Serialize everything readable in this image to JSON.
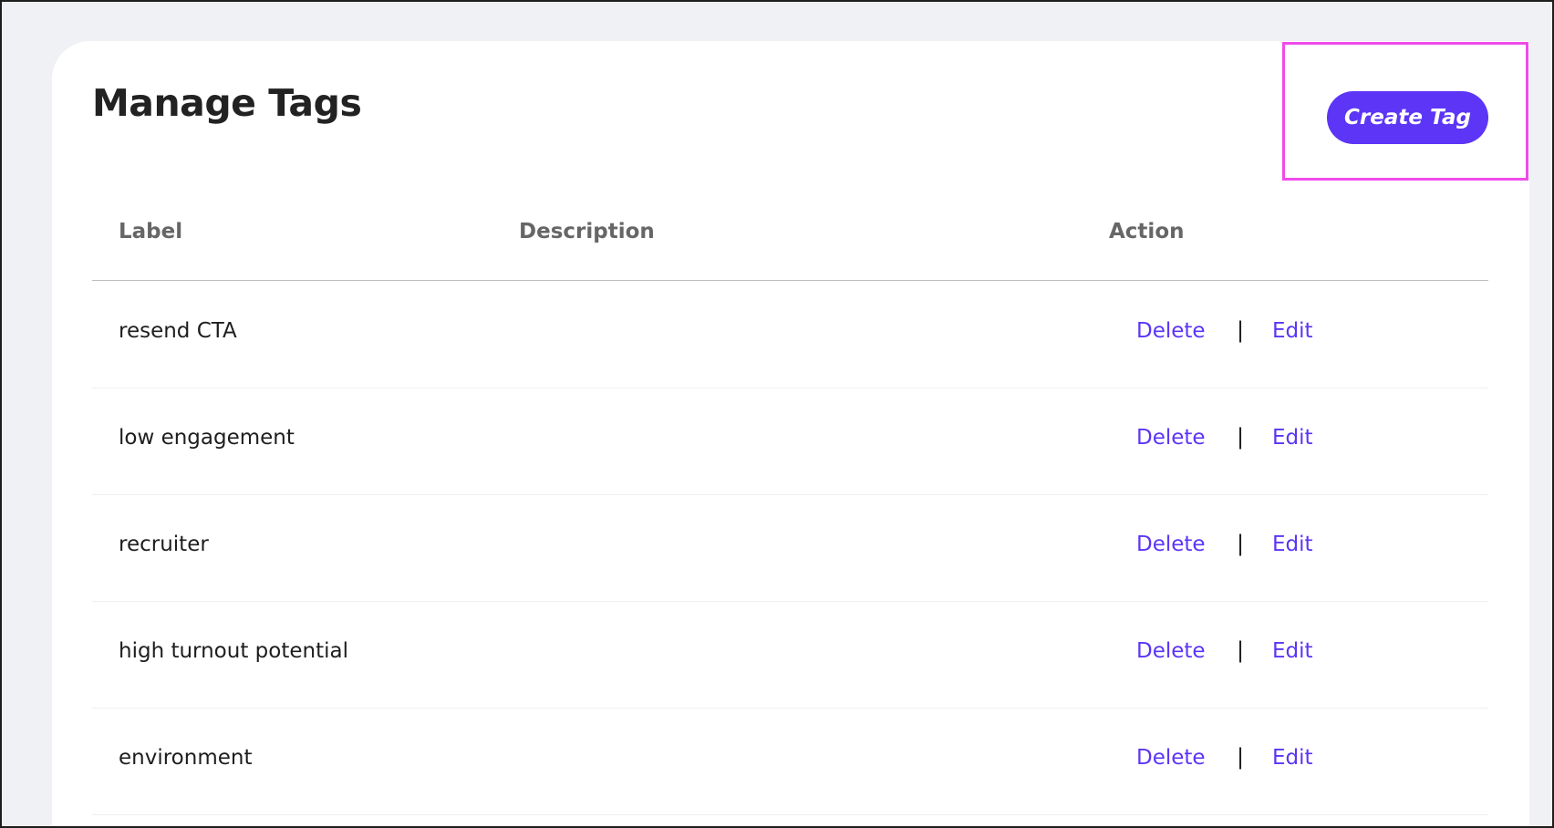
{
  "page": {
    "title": "Manage Tags",
    "create_button_label": "Create Tag",
    "accent_color": "#5c35f6",
    "highlight_color": "#ef4bea"
  },
  "table": {
    "columns": [
      "Label",
      "Description",
      "Action"
    ],
    "rows": [
      {
        "label": "resend CTA",
        "description": "",
        "delete": "Delete",
        "separator": "|",
        "edit": "Edit"
      },
      {
        "label": "low engagement",
        "description": "",
        "delete": "Delete",
        "separator": "|",
        "edit": "Edit"
      },
      {
        "label": "recruiter",
        "description": "",
        "delete": "Delete",
        "separator": "|",
        "edit": "Edit"
      },
      {
        "label": "high turnout potential",
        "description": "",
        "delete": "Delete",
        "separator": "|",
        "edit": "Edit"
      },
      {
        "label": "environment",
        "description": "",
        "delete": "Delete",
        "separator": "|",
        "edit": "Edit"
      }
    ]
  }
}
